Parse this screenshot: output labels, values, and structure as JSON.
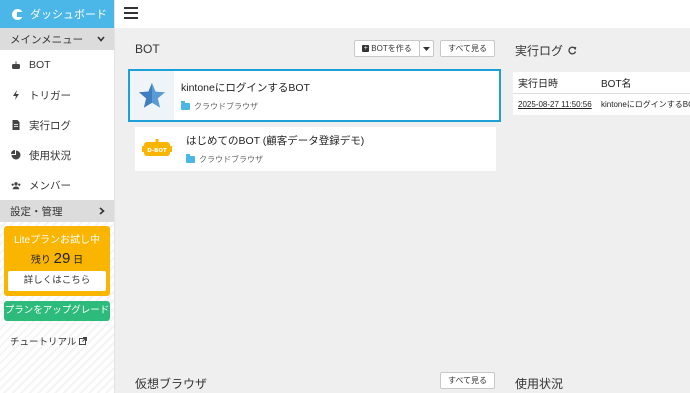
{
  "sidebar": {
    "dashboard": "ダッシュボード",
    "main_menu": "メインメニュー",
    "items": [
      {
        "label": "BOT",
        "icon": "robot-icon"
      },
      {
        "label": "トリガー",
        "icon": "bolt-icon"
      },
      {
        "label": "実行ログ",
        "icon": "file-icon"
      },
      {
        "label": "使用状況",
        "icon": "pie-chart-icon"
      },
      {
        "label": "メンバー",
        "icon": "users-icon"
      }
    ],
    "settings": "設定・管理",
    "trial": {
      "line1": "Liteプランお試し中",
      "remaining_prefix": "残り",
      "days": "29",
      "days_suffix": "日",
      "detail": "詳しくはこちら"
    },
    "upgrade": "プランをアップグレード",
    "tutorial": "チュートリアル"
  },
  "bots": {
    "title": "BOT",
    "create_label": "BOTを作る",
    "view_all": "すべて見る",
    "list": [
      {
        "name": "kintoneにログインするBOT",
        "type": "クラウドブラウザ",
        "thumb": "star-icon"
      },
      {
        "name": "はじめてのBOT (顧客データ登録デモ)",
        "type": "クラウドブラウザ",
        "thumb": "robot-logo",
        "thumb_text": "D-BOT"
      }
    ]
  },
  "exec_log": {
    "title": "実行ログ",
    "columns": [
      "実行日時",
      "BOT名"
    ],
    "rows": [
      {
        "datetime": "2025-08-27 11:50:56",
        "bot": "kintoneにログインするBOT"
      }
    ]
  },
  "virtual_browser": {
    "title": "仮想ブラウザ",
    "view_all": "すべて見る"
  },
  "usage": {
    "title": "使用状況"
  },
  "colors": {
    "accent": "#4bb7e8",
    "trial": "#f9b500",
    "upgrade": "#2dbb7b",
    "selected_border": "#1d9fd8"
  }
}
